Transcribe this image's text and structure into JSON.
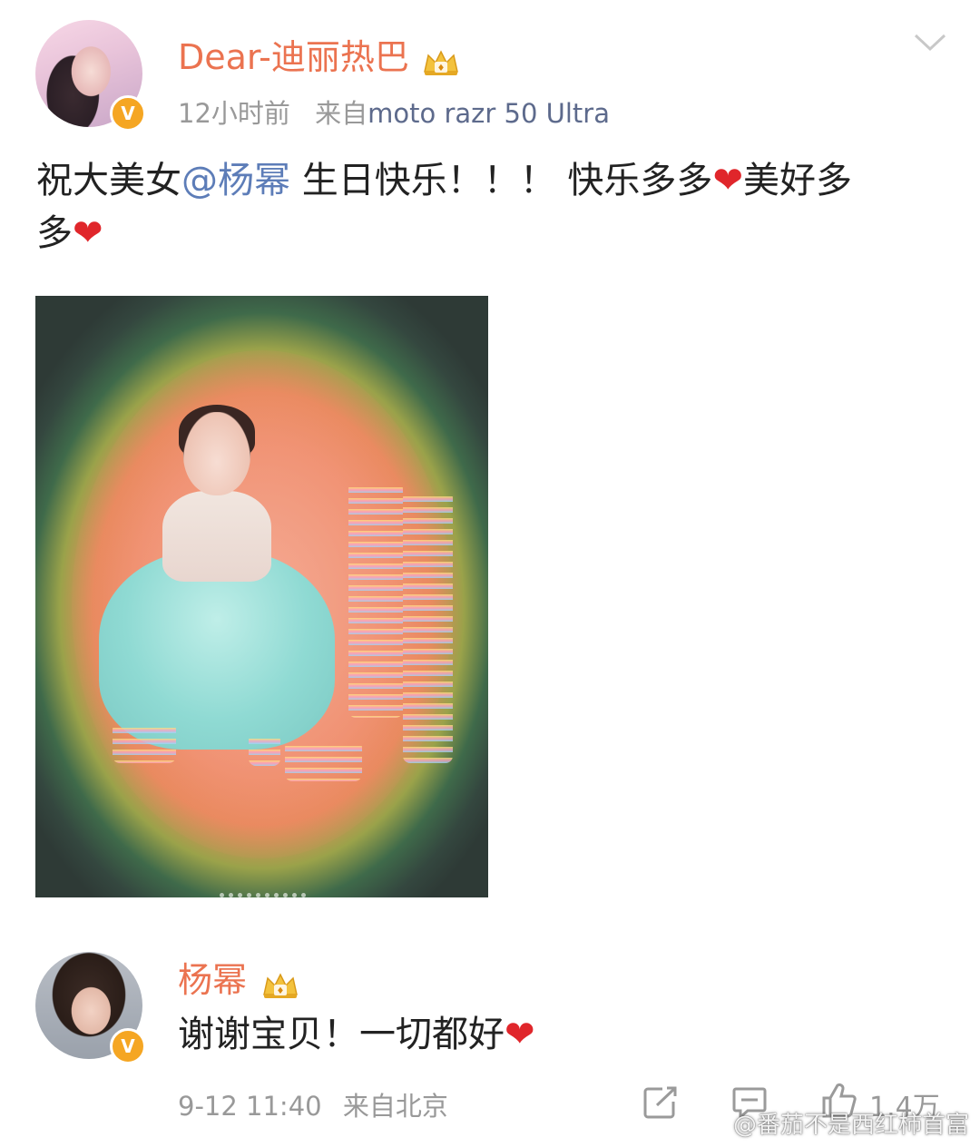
{
  "post": {
    "author": "Dear-迪丽热巴",
    "time": "12小时前",
    "source_prefix": "来自",
    "source_device": "moto razr 50 Ultra",
    "text_before_mention": "祝大美女",
    "mention": "@杨幂",
    "text_line1_after": " 生日快乐！！！ 快乐多多",
    "text_mid": "美好多",
    "text_line2": "多",
    "heart": "❤"
  },
  "comment": {
    "author": "杨幂",
    "text": "谢谢宝贝！一切都好",
    "heart": "❤",
    "date": "9-12 11:40",
    "location": "来自北京"
  },
  "actions": {
    "like_count": "1.4万"
  },
  "icons": {
    "verified": "verified-v-badge",
    "crown": "crown-vip-icon",
    "menu": "chevron-down-icon",
    "repost": "repost-icon",
    "comment": "comment-icon",
    "like": "thumbs-up-icon"
  },
  "colors": {
    "name": "#eb7350",
    "mention": "#5d7db8",
    "heart": "#e0262b",
    "meta": "#999999",
    "verified": "#f5a623"
  },
  "watermark": "@番茄不是西红柿首富"
}
